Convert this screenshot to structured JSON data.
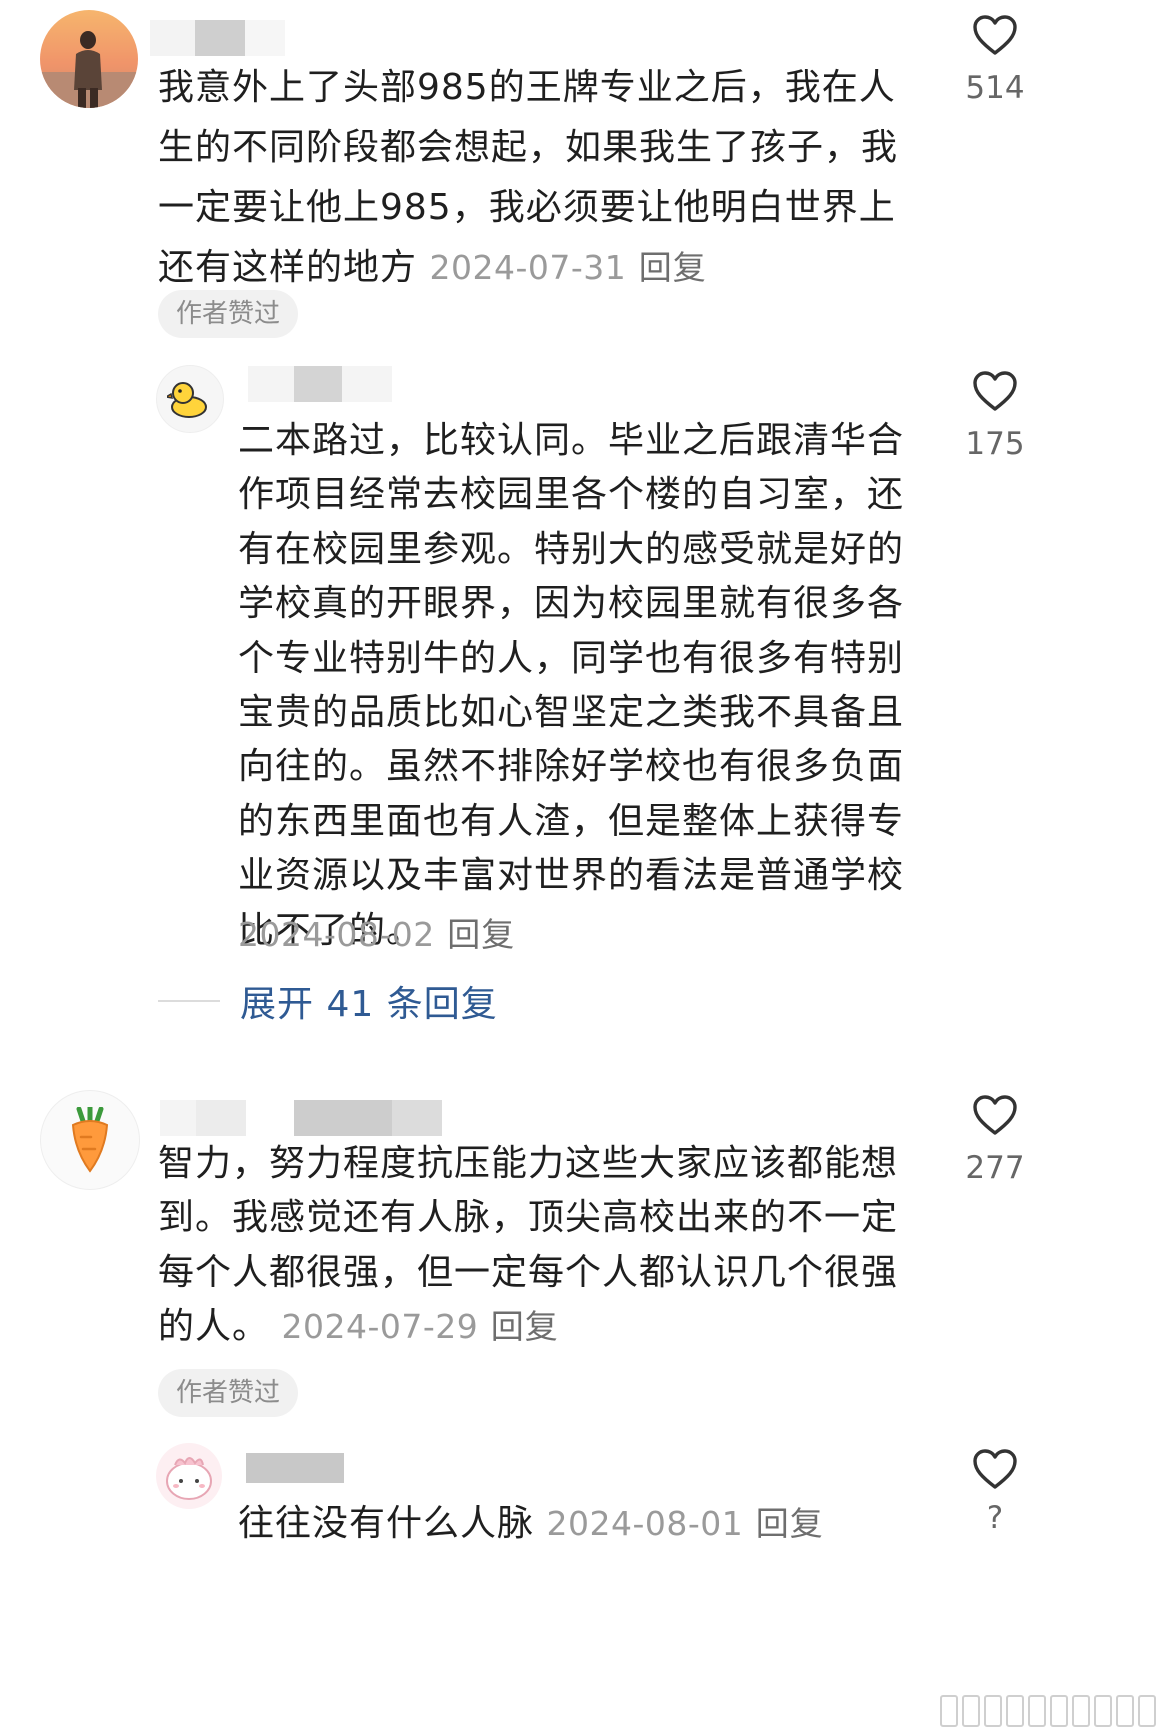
{
  "comments": [
    {
      "text": "我意外上了头部985的王牌专业之后，我在人生的不同阶段都会想起，如果我生了孩子，我一定要让他上985，我必须要让他明白世界上还有这样的地方",
      "date": "2024-07-31",
      "reply_label": "回复",
      "tag": "作者赞过",
      "likes": "514",
      "avatar_icon": "person-sunset-avatar",
      "sub": {
        "text": "二本路过，比较认同。毕业之后跟清华合作项目经常去校园里各个楼的自习室，还有在校园里参观。特别大的感受就是好的学校真的开眼界，因为校园里就有很多各个专业特别牛的人，同学也有很多有特别宝贵的品质比如心智坚定之类我不具备且向往的。虽然不排除好学校也有很多负面的东西里面也有人渣，但是整体上获得专业资源以及丰富对世界的看法是普通学校比不了的。",
        "date": "2024-08-02",
        "reply_label": "回复",
        "likes": "175",
        "avatar_icon": "duck-avatar"
      },
      "expand_label": "展开 41 条回复"
    },
    {
      "text": "智力，努力程度抗压能力这些大家应该都能想到。我感觉还有人脉，顶尖高校出来的不一定每个人都很强，但一定每个人都认识几个很强的人。",
      "date": "2024-07-29",
      "reply_label": "回复",
      "tag": "作者赞过",
      "likes": "277",
      "avatar_icon": "carrot-avatar",
      "sub": {
        "text": "往往没有什么人脉",
        "date": "2024-08-01",
        "reply_label": "回复",
        "likes": "?",
        "avatar_icon": "pink-cartoon-avatar"
      }
    }
  ]
}
